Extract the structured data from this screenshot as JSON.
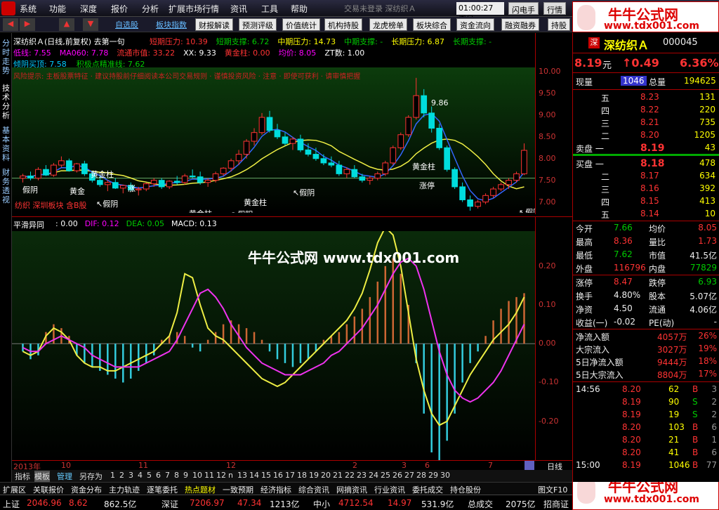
{
  "menu": [
    "系统",
    "功能",
    "深度",
    "报价",
    "分析",
    "扩展市场行情",
    "资讯",
    "工具",
    "帮助"
  ],
  "header_center": "交易未登录    深纺织Ａ",
  "clock": "01:00:27 周日",
  "top_buttons": [
    "闪电手",
    "行情"
  ],
  "banner_top": {
    "title": "牛牛公式网",
    "url": "www.tdx001.com"
  },
  "toolbar": {
    "links": [
      "自选股",
      "板块指数"
    ],
    "buttons": [
      "财报解读",
      "预测评级",
      "价值统计",
      "机构持股",
      "龙虎榜单",
      "板块综合",
      "资金流向",
      "融资融券",
      "持股"
    ]
  },
  "vtabs": [
    "分时走势",
    "技术分析",
    "基本资料",
    "财务透视"
  ],
  "kline": {
    "title": "深纺织Ａ(日线,前复权) 去第一句",
    "info1": [
      {
        "t": "短期压力: 10.39",
        "c": "#f33"
      },
      {
        "t": "短期支撑: 6.72",
        "c": "#0c0"
      },
      {
        "t": "中期压力: 14.73",
        "c": "#ff0"
      },
      {
        "t": "中期支撑: -",
        "c": "#0c0"
      },
      {
        "t": "长期压力: 6.87",
        "c": "#ff0"
      },
      {
        "t": "长期支撑: -",
        "c": "#0c0"
      }
    ],
    "info2": [
      {
        "t": "低线: 7.55",
        "c": "#f0f"
      },
      {
        "t": "MA060: 7.78",
        "c": "#f0f"
      },
      {
        "t": "流通市值: 33.22",
        "c": "#f33"
      },
      {
        "t": "XX: 9.33",
        "c": "#fff"
      },
      {
        "t": "黄金柱: 0.00",
        "c": "#f33"
      },
      {
        "t": "均价: 8.05",
        "c": "#f0f"
      },
      {
        "t": "ZT数: 1.00",
        "c": "#fff"
      }
    ],
    "info3": [
      {
        "t": "倾阴买顶: 7.58",
        "c": "#0cf"
      },
      {
        "t": "积极点精准线: 7.62",
        "c": "#0c0"
      }
    ],
    "warning": "风险提示: 主板股票特征 · 建议持股前仔细阅读本公司交易规则 · 谨慎投资风险 · 注意 · 即使可获利 · 请审慎把握",
    "sector_note": "纺织  深圳板块  含B股",
    "labels": [
      {
        "t": "假阴",
        "x": 15,
        "y": 178
      },
      {
        "t": "黄金",
        "x": 82,
        "y": 180
      },
      {
        "t": "黄金柱",
        "x": 112,
        "y": 156
      },
      {
        "t": "↖假阴",
        "x": 120,
        "y": 198
      },
      {
        "t": "涨",
        "x": 165,
        "y": 176
      },
      {
        "t": "↖假阴",
        "x": 212,
        "y": 222
      },
      {
        "t": "黄金柱",
        "x": 252,
        "y": 212
      },
      {
        "t": "↖假阴",
        "x": 312,
        "y": 213
      },
      {
        "t": "黄金柱",
        "x": 330,
        "y": 196
      },
      {
        "t": "↖假阴",
        "x": 400,
        "y": 182
      },
      {
        "t": "黄金柱",
        "x": 570,
        "y": 145
      },
      {
        "t": "涨停",
        "x": 580,
        "y": 172
      },
      {
        "t": "9.86",
        "x": 597,
        "y": 54
      },
      {
        "t": "6.80",
        "x": 648,
        "y": 241
      },
      {
        "t": "↖假阴",
        "x": 722,
        "y": 210
      }
    ],
    "yticks": [
      "10.00",
      "9.50",
      "9.00",
      "8.50",
      "8.00",
      "7.50",
      "7.00"
    ],
    "ylim": [
      6.75,
      10.1
    ],
    "candles": [
      [
        7.55,
        7.65,
        7.45,
        7.6
      ],
      [
        7.6,
        7.7,
        7.5,
        7.55
      ],
      [
        7.55,
        7.8,
        7.5,
        7.75
      ],
      [
        7.75,
        7.85,
        7.6,
        7.62
      ],
      [
        7.62,
        7.9,
        7.58,
        7.85
      ],
      [
        7.85,
        8.05,
        7.8,
        7.95
      ],
      [
        7.95,
        8.0,
        7.7,
        7.72
      ],
      [
        7.72,
        7.9,
        7.68,
        7.88
      ],
      [
        7.88,
        7.95,
        7.6,
        7.65
      ],
      [
        7.65,
        7.7,
        7.45,
        7.5
      ],
      [
        7.5,
        7.6,
        7.35,
        7.4
      ],
      [
        7.4,
        7.5,
        7.25,
        7.45
      ],
      [
        7.45,
        7.55,
        7.3,
        7.32
      ],
      [
        7.32,
        7.4,
        7.2,
        7.38
      ],
      [
        7.38,
        7.45,
        7.25,
        7.28
      ],
      [
        7.28,
        7.35,
        7.15,
        7.3
      ],
      [
        7.3,
        7.45,
        7.25,
        7.42
      ],
      [
        7.42,
        7.55,
        7.35,
        7.5
      ],
      [
        7.5,
        7.55,
        7.3,
        7.35
      ],
      [
        7.35,
        7.5,
        7.3,
        7.48
      ],
      [
        7.48,
        7.6,
        7.4,
        7.45
      ],
      [
        7.45,
        7.65,
        7.4,
        7.6
      ],
      [
        7.6,
        7.75,
        7.55,
        7.58
      ],
      [
        7.58,
        7.7,
        7.4,
        7.45
      ],
      [
        7.45,
        7.55,
        7.35,
        7.5
      ],
      [
        7.5,
        7.7,
        7.45,
        7.65
      ],
      [
        7.65,
        7.8,
        7.6,
        7.78
      ],
      [
        7.78,
        8.0,
        7.7,
        7.95
      ],
      [
        7.95,
        8.2,
        7.85,
        8.1
      ],
      [
        8.1,
        8.45,
        8.0,
        8.4
      ],
      [
        8.4,
        8.7,
        8.3,
        8.6
      ],
      [
        8.6,
        9.05,
        8.55,
        8.95
      ],
      [
        8.95,
        9.1,
        8.6,
        8.65
      ],
      [
        8.65,
        8.8,
        8.45,
        8.5
      ],
      [
        8.5,
        8.6,
        8.3,
        8.35
      ],
      [
        8.35,
        8.5,
        8.2,
        8.45
      ],
      [
        8.45,
        8.55,
        8.15,
        8.2
      ],
      [
        8.2,
        8.35,
        8.05,
        8.1
      ],
      [
        8.1,
        8.25,
        7.95,
        8.0
      ],
      [
        8.0,
        8.1,
        7.85,
        7.9
      ],
      [
        7.9,
        8.05,
        7.8,
        7.85
      ],
      [
        7.85,
        7.95,
        7.6,
        7.65
      ],
      [
        7.65,
        7.8,
        7.55,
        7.75
      ],
      [
        7.75,
        7.85,
        7.55,
        7.58
      ],
      [
        7.58,
        7.65,
        7.45,
        7.5
      ],
      [
        7.5,
        7.6,
        7.4,
        7.55
      ],
      [
        7.55,
        7.7,
        7.5,
        7.65
      ],
      [
        7.65,
        7.95,
        7.6,
        7.9
      ],
      [
        7.9,
        8.3,
        7.85,
        8.25
      ],
      [
        8.25,
        8.6,
        8.2,
        8.55
      ],
      [
        8.55,
        9.0,
        8.5,
        8.95
      ],
      [
        8.95,
        9.86,
        8.9,
        9.45
      ],
      [
        9.45,
        9.6,
        8.95,
        9.05
      ],
      [
        9.05,
        9.2,
        8.6,
        8.7
      ],
      [
        8.7,
        8.8,
        8.2,
        8.25
      ],
      [
        8.25,
        8.3,
        7.7,
        7.75
      ],
      [
        7.75,
        7.8,
        7.3,
        7.35
      ],
      [
        7.35,
        7.45,
        7.0,
        7.05
      ],
      [
        7.05,
        7.15,
        6.8,
        6.9
      ],
      [
        6.9,
        7.05,
        6.85,
        7.0
      ],
      [
        7.0,
        7.2,
        6.95,
        7.15
      ],
      [
        7.15,
        7.35,
        7.1,
        7.3
      ],
      [
        7.3,
        7.45,
        7.25,
        7.4
      ],
      [
        7.4,
        7.55,
        7.3,
        7.5
      ],
      [
        7.5,
        7.7,
        7.45,
        7.65
      ],
      [
        7.65,
        8.35,
        7.62,
        8.19
      ]
    ]
  },
  "macd": {
    "title": "平滑异同",
    "vals": [
      {
        "t": ": 0.00",
        "c": "#fff"
      },
      {
        "t": "DIF: 0.12",
        "c": "#f0f"
      },
      {
        "t": "DEA: 0.05",
        "c": "#0c0"
      },
      {
        "t": "MACD: 0.13",
        "c": "#fff"
      }
    ],
    "yticks": [
      "0.20",
      "0.10",
      "0.00",
      "-0.10",
      "-0.20"
    ],
    "ylim": [
      -0.3,
      0.29
    ],
    "hist": [
      -0.02,
      -0.04,
      -0.03,
      0.03,
      0.05,
      0.04,
      0.02,
      -0.03,
      -0.05,
      -0.06,
      -0.07,
      -0.08,
      -0.09,
      -0.1,
      -0.09,
      -0.07,
      -0.05,
      -0.03,
      0.01,
      0.02,
      0.03,
      0.02,
      -0.01,
      -0.02,
      0.01,
      0.03,
      0.05,
      0.06,
      0.05,
      0.04,
      0.03,
      0.01,
      -0.02,
      -0.04,
      -0.05,
      -0.06,
      -0.05,
      -0.04,
      -0.02,
      0.01,
      0.02,
      0.03,
      0.05,
      0.07,
      0.09,
      0.12,
      0.16,
      0.2,
      0.22,
      0.18,
      0.1,
      -0.05,
      -0.18,
      -0.28,
      -0.3,
      -0.25,
      -0.18,
      -0.1,
      -0.05,
      -0.02,
      0.02,
      0.06,
      0.09,
      0.11,
      0.12,
      0.13
    ],
    "dif": [
      -0.02,
      -0.03,
      -0.02,
      0.02,
      0.04,
      0.03,
      0.01,
      -0.03,
      -0.05,
      -0.06,
      -0.06,
      -0.07,
      -0.07,
      -0.06,
      -0.05,
      -0.04,
      -0.03,
      -0.02,
      0.0,
      0.02,
      0.08,
      0.18,
      0.17,
      0.1,
      0.04,
      0.02,
      0.01,
      -0.01,
      -0.03,
      -0.05,
      -0.07,
      -0.09,
      -0.1,
      -0.11,
      -0.1,
      -0.08,
      -0.06,
      -0.04,
      -0.02,
      0.0,
      0.02,
      0.04,
      0.06,
      0.09,
      0.13,
      0.19,
      0.26,
      0.3,
      0.28,
      0.2,
      0.08,
      -0.04,
      -0.12,
      -0.18,
      -0.21,
      -0.2,
      -0.16,
      -0.12,
      -0.08,
      -0.05,
      -0.02,
      0.01,
      0.03,
      0.05,
      0.08,
      0.12
    ],
    "dea": [
      -0.01,
      -0.02,
      -0.02,
      0.0,
      0.01,
      0.02,
      0.01,
      0.0,
      -0.01,
      -0.03,
      -0.04,
      -0.05,
      -0.06,
      -0.06,
      -0.06,
      -0.06,
      -0.05,
      -0.04,
      -0.03,
      -0.02,
      0.01,
      0.05,
      0.09,
      0.13,
      0.14,
      0.12,
      0.09,
      0.05,
      0.02,
      -0.01,
      -0.03,
      -0.05,
      -0.06,
      -0.07,
      -0.08,
      -0.08,
      -0.08,
      -0.07,
      -0.06,
      -0.05,
      -0.03,
      -0.02,
      0.0,
      0.02,
      0.04,
      0.07,
      0.1,
      0.14,
      0.18,
      0.21,
      0.22,
      0.2,
      0.14,
      0.06,
      -0.02,
      -0.08,
      -0.12,
      -0.14,
      -0.15,
      -0.14,
      -0.12,
      -0.1,
      -0.07,
      -0.03,
      0.01,
      0.05
    ]
  },
  "watermark": "牛牛公式网  www.tdx001.com",
  "dates": [
    {
      "t": "2013年",
      "x": 2
    },
    {
      "t": "10",
      "x": 70
    },
    {
      "t": "11",
      "x": 180
    },
    {
      "t": "12",
      "x": 305
    },
    {
      "t": "2",
      "x": 485
    },
    {
      "t": "3",
      "x": 555
    },
    {
      "t": "6",
      "x": 588
    },
    {
      "t": "7",
      "x": 678
    }
  ],
  "period": "日线",
  "pagebar": {
    "items": [
      "指标",
      "模板",
      "管理",
      "另存为"
    ],
    "pages": [
      "1",
      "2",
      "3",
      "4",
      "5",
      "6",
      "7",
      "8",
      "9",
      "10",
      "11",
      "12",
      "n",
      "13",
      "14",
      "15",
      "16",
      "17",
      "18",
      "19",
      "20",
      "21",
      "22",
      "23",
      "24",
      "25",
      "26",
      "27",
      "28",
      "29",
      "30"
    ]
  },
  "funcbar": [
    "扩展区",
    "关联报价",
    "资金分布",
    "主力轨迹",
    "逐笔委托",
    "热点题材",
    "一致预期",
    "经济指标",
    "综合资讯",
    "网摘资讯",
    "行业资讯",
    "委托成交",
    "持仓股份"
  ],
  "funcbar_right": "图文F10",
  "status": [
    {
      "t": "上证",
      "c": "#eee"
    },
    {
      "t": "2046.96",
      "c": "#f33"
    },
    {
      "t": "8.62",
      "c": "#f33"
    },
    {
      "t": "862.5亿",
      "c": "#eee"
    },
    {
      "t": "深证",
      "c": "#eee"
    },
    {
      "t": "7206.97",
      "c": "#f33"
    },
    {
      "t": "47.34",
      "c": "#f33"
    },
    {
      "t": "1213亿",
      "c": "#eee"
    },
    {
      "t": "中小",
      "c": "#eee"
    },
    {
      "t": "4712.54",
      "c": "#f33"
    },
    {
      "t": "14.97",
      "c": "#f33"
    },
    {
      "t": "531.9亿",
      "c": "#eee"
    },
    {
      "t": "总成交",
      "c": "#eee"
    },
    {
      "t": "2075亿",
      "c": "#eee"
    },
    {
      "t": "招商证",
      "c": "#eee"
    }
  ],
  "banner_bottom": {
    "title": "牛牛公式网",
    "url": "www.tdx001.com"
  },
  "stock": {
    "badge": "深",
    "name": "深纺织Ａ",
    "code": "000045",
    "price": "8.19",
    "unit": "元",
    "change": "↑0.49",
    "pct": "6.36%",
    "now_label": "现量",
    "now": "1046",
    "total_label": "总量",
    "total": "194625",
    "asks": [
      {
        "lvl": "五",
        "p": "8.23",
        "v": "131"
      },
      {
        "lvl": "四",
        "p": "8.22",
        "v": "220"
      },
      {
        "lvl": "三",
        "p": "8.21",
        "v": "735"
      },
      {
        "lvl": "二",
        "p": "8.20",
        "v": "1205"
      },
      {
        "lvl": "卖盘 一",
        "p": "8.19",
        "v": "43"
      }
    ],
    "bids": [
      {
        "lvl": "买盘 一",
        "p": "8.18",
        "v": "478"
      },
      {
        "lvl": "二",
        "p": "8.17",
        "v": "634"
      },
      {
        "lvl": "三",
        "p": "8.16",
        "v": "392"
      },
      {
        "lvl": "四",
        "p": "8.15",
        "v": "413"
      },
      {
        "lvl": "五",
        "p": "8.14",
        "v": "10"
      }
    ],
    "stats": [
      {
        "l1": "今开",
        "v1": "7.66",
        "c1": "#0c0",
        "l2": "均价",
        "v2": "8.05",
        "c2": "#f33"
      },
      {
        "l1": "最高",
        "v1": "8.36",
        "c1": "#f33",
        "l2": "量比",
        "v2": "1.73",
        "c2": "#f33"
      },
      {
        "l1": "最低",
        "v1": "7.62",
        "c1": "#0c0",
        "l2": "市值",
        "v2": "41.5亿",
        "c2": "#eee"
      },
      {
        "l1": "外盘",
        "v1": "116796",
        "c1": "#f33",
        "l2": "内盘",
        "v2": "77829",
        "c2": "#0c0"
      }
    ],
    "stats2": [
      {
        "l1": "涨停",
        "v1": "8.47",
        "c1": "#f33",
        "l2": "跌停",
        "v2": "6.93",
        "c2": "#0c0"
      },
      {
        "l1": "换手",
        "v1": "4.80%",
        "c1": "#eee",
        "l2": "股本",
        "v2": "5.07亿",
        "c2": "#eee"
      },
      {
        "l1": "净资",
        "v1": "4.50",
        "c1": "#eee",
        "l2": "流通",
        "v2": "4.06亿",
        "c2": "#eee"
      },
      {
        "l1": "收益(一)",
        "v1": "-0.02",
        "c1": "#eee",
        "l2": "PE(动)",
        "v2": "-",
        "c2": "#eee"
      }
    ],
    "flows": [
      {
        "l": "净流入额",
        "v": "4057万",
        "p": "26%"
      },
      {
        "l": "大宗流入",
        "v": "3027万",
        "p": "19%"
      },
      {
        "l": "5日净流入额",
        "v": "9444万",
        "p": "18%"
      },
      {
        "l": "5日大宗流入",
        "v": "8804万",
        "p": "17%"
      }
    ],
    "ticks": [
      {
        "t": "14:56",
        "p": "8.20",
        "v": "62",
        "s": "B",
        "n": "3"
      },
      {
        "t": "",
        "p": "8.19",
        "v": "90",
        "s": "S",
        "n": "2"
      },
      {
        "t": "",
        "p": "8.19",
        "v": "19",
        "s": "S",
        "n": "2"
      },
      {
        "t": "",
        "p": "8.20",
        "v": "103",
        "s": "B",
        "n": "6"
      },
      {
        "t": "",
        "p": "8.20",
        "v": "21",
        "s": "B",
        "n": "1"
      },
      {
        "t": "",
        "p": "8.20",
        "v": "41",
        "s": "B",
        "n": "6"
      },
      {
        "t": "15:00",
        "p": "8.19",
        "v": "1046",
        "s": "B",
        "n": "77"
      }
    ]
  }
}
